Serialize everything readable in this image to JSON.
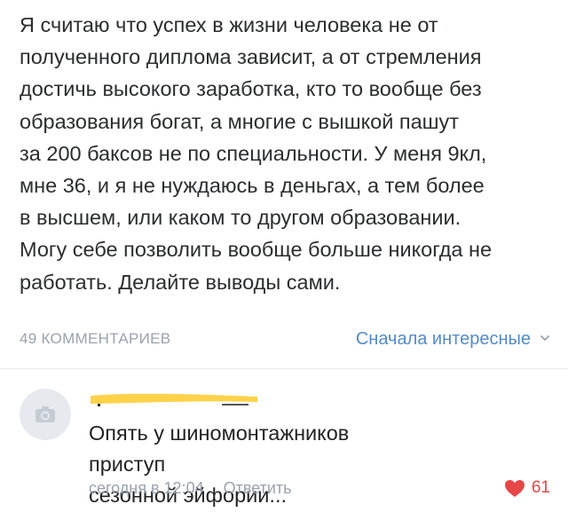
{
  "post": {
    "text": "Я считаю что успех в жизни человека не от\nполученного диплома зависит, а от стремления\nдостичь высокого заработка, кто то вообще без\nобразования богат, а многие с вышкой пашут\nза 200 баксов не по специальности. У меня 9кл,\nмне 36, и я не нуждаюсь в деньгах, а тем более\nв высшем, или каком то другом образовании.\nМогу себе позволить вообще больше никогда не\nработать. Делайте выводы сами."
  },
  "comments_header": {
    "count_label": "49 КОММЕНТАРИЕВ",
    "sort_label": "Сначала интересные",
    "sort_icon": "chevron-down-icon"
  },
  "comment": {
    "avatar_icon": "camera-icon",
    "author_name_redacted": true,
    "text": "Опять у шиномонтажников приступ\nсезонной эйфории...",
    "time": "сегодня в 12:04",
    "reply_label": "Ответить",
    "like_icon": "heart-icon",
    "likes": "61"
  },
  "colors": {
    "accent": "#528bcc",
    "meta": "#99a2ad",
    "like": "#e64646",
    "highlight": "#ffd24a"
  }
}
